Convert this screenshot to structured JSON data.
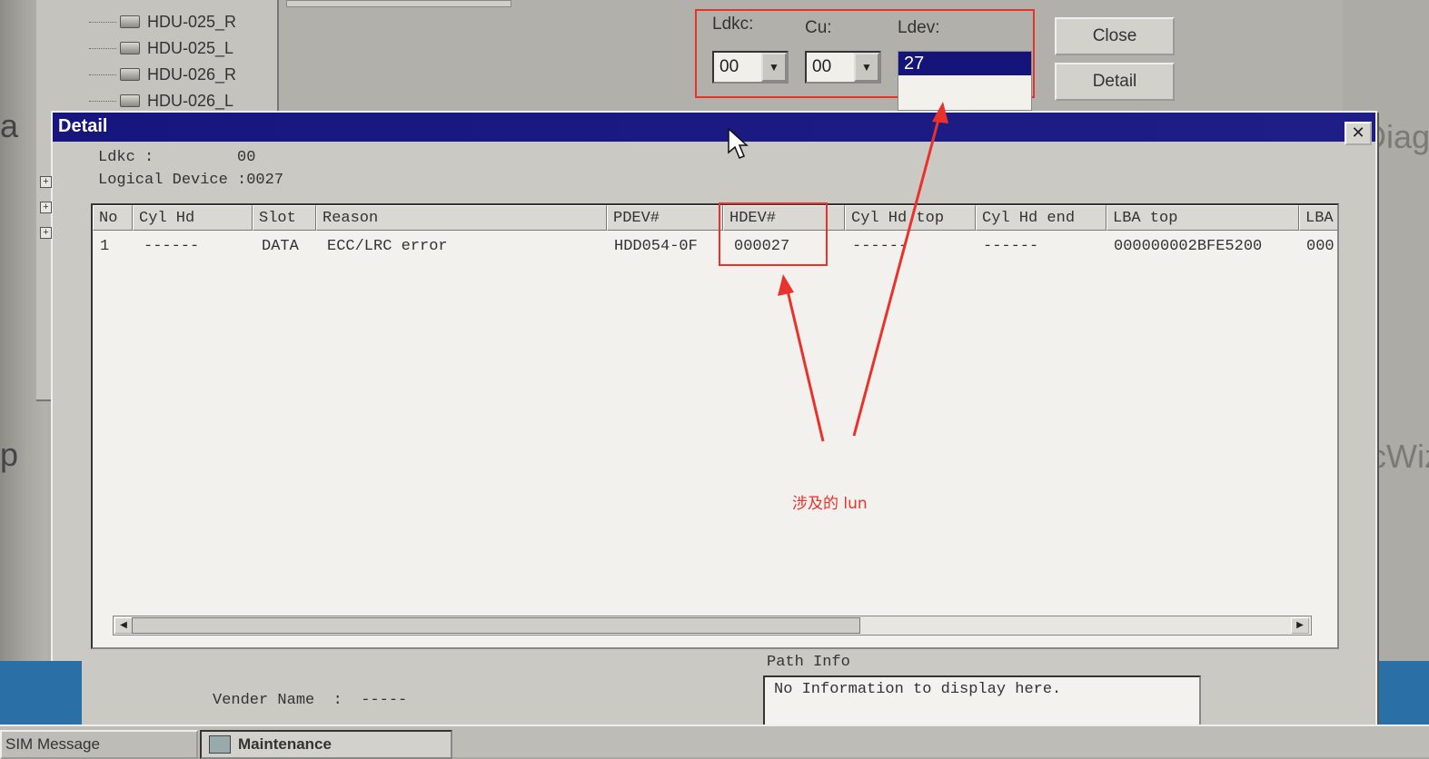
{
  "background": {
    "left_text_top": "a",
    "left_text_bottom": "p",
    "right_text_top": "Diag",
    "right_text_bottom": "FcWiz",
    "tree_items": [
      "HDU-025_R",
      "HDU-025_L",
      "HDU-026_R",
      "HDU-026_L"
    ],
    "expanders": [
      "+",
      "+",
      "+"
    ],
    "selector": {
      "ldkc_label": "Ldkc:",
      "cu_label": "Cu:",
      "ldev_label": "Ldev:",
      "ldkc_value": "00",
      "cu_value": "00",
      "ldev_selected": "27"
    },
    "buttons": {
      "close": "Close",
      "detail": "Detail"
    }
  },
  "dialog": {
    "title": "Detail",
    "close_glyph": "✕",
    "ldkc_line": "Ldkc :         00",
    "logical_device_line": "Logical Device :0027",
    "columns": [
      "No",
      "Cyl Hd",
      "Slot",
      "Reason",
      "PDEV#",
      "HDEV#",
      "Cyl Hd top",
      "Cyl Hd end",
      "LBA top",
      "LBA"
    ],
    "rows": [
      {
        "no": "1",
        "cyl_hd": "------",
        "slot": "DATA",
        "reason": "ECC/LRC error",
        "pdev": "HDD054-0F",
        "hdev": "000027",
        "cyl_hd_top": "------",
        "cyl_hd_end": "------",
        "lba_top": "000000002BFE5200",
        "lba_end": "000"
      }
    ],
    "path_info_label": "Path Info",
    "path_info_text": "No Information to display here.",
    "vendor_line": "Vender Name  :  -----"
  },
  "annotation": {
    "text": "涉及的 lun",
    "color": "#e8322b"
  },
  "taskbar": {
    "sim_message": "SIM Message",
    "maintenance": "Maintenance"
  },
  "colors": {
    "title_bar": "#16167e",
    "highlight": "#e8322b"
  }
}
